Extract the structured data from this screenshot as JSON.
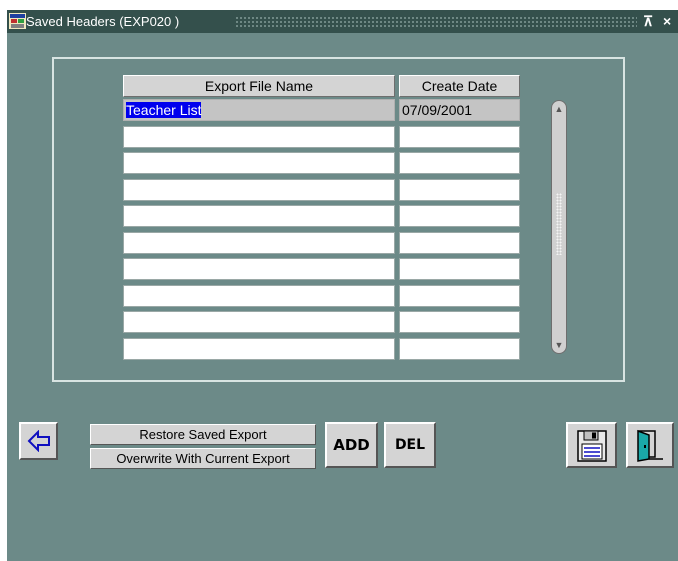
{
  "window": {
    "title": "Saved Headers (EXP020 )",
    "restore_glyph": "⊼",
    "close_glyph": "×"
  },
  "table": {
    "columns": [
      "Export File Name",
      "Create Date"
    ],
    "rows": [
      {
        "name": "Teacher List",
        "date": "07/09/2001"
      },
      {
        "name": "",
        "date": ""
      },
      {
        "name": "",
        "date": ""
      },
      {
        "name": "",
        "date": ""
      },
      {
        "name": "",
        "date": ""
      },
      {
        "name": "",
        "date": ""
      },
      {
        "name": "",
        "date": ""
      },
      {
        "name": "",
        "date": ""
      },
      {
        "name": "",
        "date": ""
      },
      {
        "name": "",
        "date": ""
      }
    ]
  },
  "scrollbar": {
    "up_glyph": "▲",
    "down_glyph": "▼"
  },
  "buttons": {
    "restore_saved_export": "Restore Saved Export",
    "overwrite_current_export": "Overwrite With Current Export",
    "add": "ADD",
    "del": "DEL"
  },
  "icons": {
    "app": "app-window-icon",
    "back": "back-arrow-icon",
    "save": "floppy-disk-icon",
    "exit": "exit-door-icon"
  },
  "colors": {
    "window_bg": "#6c8a88",
    "titlebar_bg": "#34504c",
    "selection": "#0000ee",
    "button_face": "#d4d4d4"
  }
}
